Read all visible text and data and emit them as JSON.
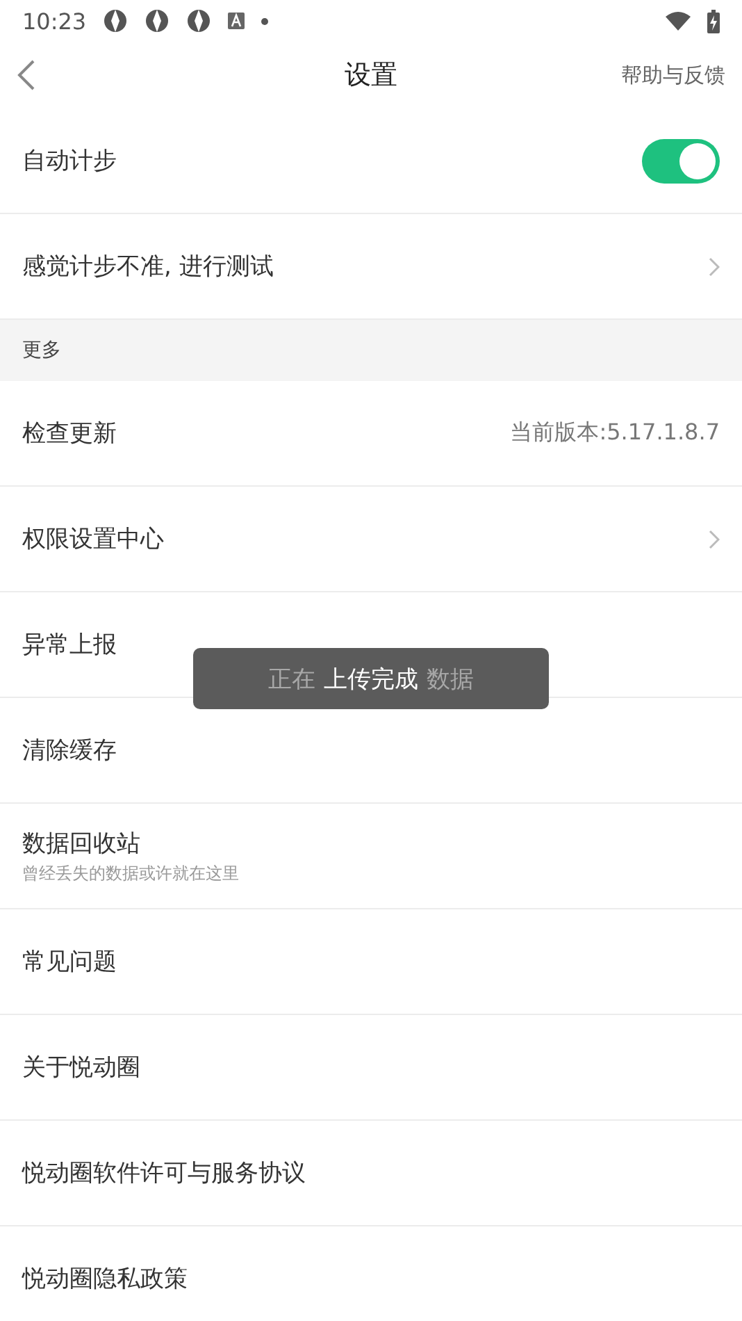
{
  "status_bar": {
    "time": "10:23",
    "notification_icons": [
      {
        "kind": "app"
      },
      {
        "kind": "app"
      },
      {
        "kind": "app"
      },
      {
        "kind": "keyboard"
      },
      {
        "kind": "dot"
      }
    ]
  },
  "header": {
    "title": "设置",
    "action": "帮助与反馈"
  },
  "rows": [
    {
      "kind": "toggle",
      "label": "自动计步",
      "on": true
    },
    {
      "kind": "chevron",
      "label": "感觉计步不准, 进行测试"
    },
    {
      "kind": "section",
      "label": "更多"
    },
    {
      "kind": "value",
      "label": "检查更新",
      "value": "当前版本:5.17.1.8.7"
    },
    {
      "kind": "chevron",
      "label": "权限设置中心"
    },
    {
      "kind": "plain",
      "label": "异常上报"
    },
    {
      "kind": "plain",
      "label": "清除缓存"
    },
    {
      "kind": "sub",
      "label": "数据回收站",
      "subtitle": "曾经丢失的数据或许就在这里"
    },
    {
      "kind": "plain",
      "label": "常见问题"
    },
    {
      "kind": "plain",
      "label": "关于悦动圈"
    },
    {
      "kind": "plain",
      "label": "悦动圈软件许可与服务协议"
    },
    {
      "kind": "plain",
      "label": "悦动圈隐私政策"
    }
  ],
  "toast": {
    "text": "上传完成",
    "faded_left": "正在",
    "faded_right": "数据"
  }
}
